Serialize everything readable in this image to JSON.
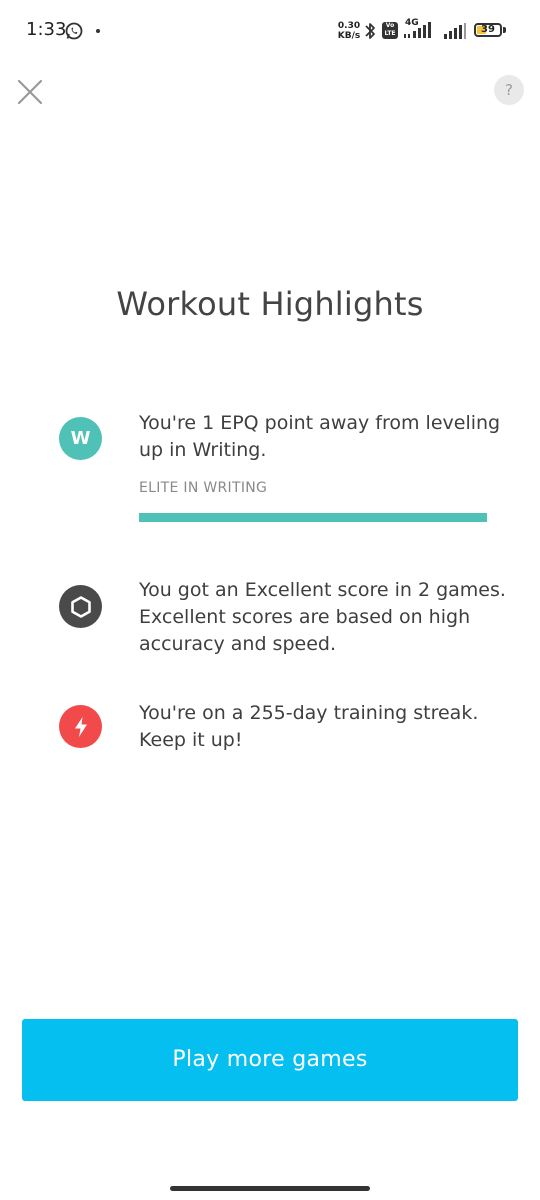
{
  "status_bar": {
    "time": "1:33",
    "net_speed_value": "0.30",
    "net_speed_unit": "KB/s",
    "volte": "Vo\nLTE",
    "network_type": "4G",
    "battery_level": 39,
    "battery_text": "39",
    "battery_color": "#f5c33b"
  },
  "header": {
    "close_icon": "close-icon",
    "help_label": "?"
  },
  "title": "Workout Highlights",
  "highlights": [
    {
      "icon_letter": "W",
      "icon_color": "#4fc1b6",
      "text": "You're 1 EPQ point away from leveling up in Writing.",
      "level_label": "ELITE IN WRITING",
      "progress": 1.0
    },
    {
      "icon": "hexagon-icon",
      "icon_color": "#4a4a4a",
      "text": "You got an Excellent score in 2 games. Excellent scores are based on high accuracy and speed."
    },
    {
      "icon": "lightning-bolt-icon",
      "icon_color": "#f24a4a",
      "text": "You're on a 255-day training streak. Keep it up!"
    }
  ],
  "play_button": {
    "label": "Play more games",
    "color": "#05bff0"
  }
}
